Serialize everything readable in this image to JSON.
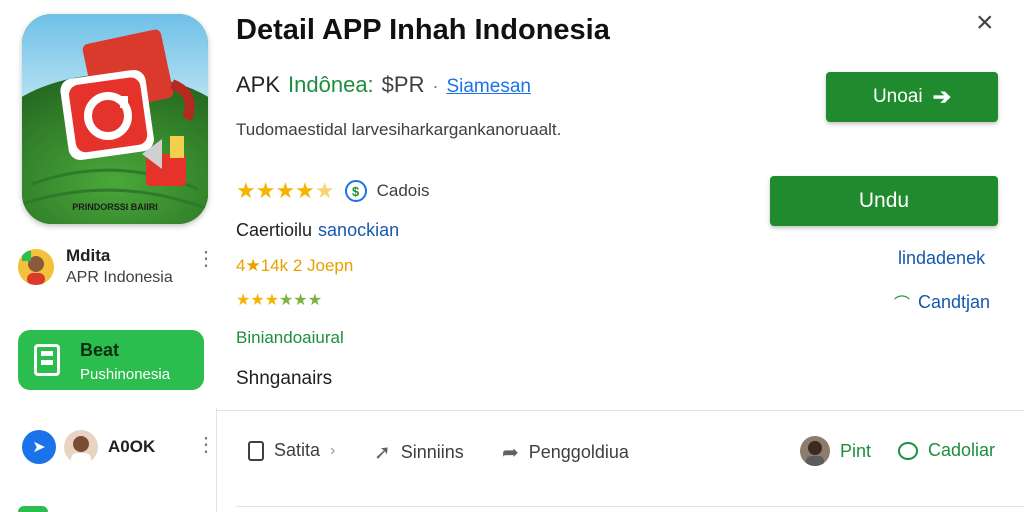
{
  "header": {
    "title": "Detail APP Inhah Indonesia",
    "close_icon": "close-icon"
  },
  "app": {
    "subtitle_prefix": "APK",
    "subtitle_green": "Indônea:",
    "subtitle_price": "$PR",
    "subtitle_dot": "·",
    "subtitle_link": "Siamesan",
    "description": "Tudomaestidal larvesiharkargankanoruaalt.",
    "icon_caption": "PRINDORSSI BAIIRI",
    "rating_stars": 4.5,
    "rating_label": "Cadois",
    "category_prefix": "Caertioilu",
    "category_link": "sanockian",
    "downloads_text": "4★14k 2 Joepn",
    "small_rating_stars": 5,
    "developer_label": "Biniandoaiural",
    "changes_label": "Shnganairs"
  },
  "buttons": {
    "primary_top": "Unoai",
    "primary_main": "Undu"
  },
  "right_links": {
    "link1": "lindadenek",
    "link2": "Candtjan"
  },
  "sidebar": {
    "profile": {
      "name": "Mdita",
      "sub": "APR Indonesia"
    },
    "card": {
      "title": "Beat",
      "sub": "Pushinonesia"
    },
    "bottom": {
      "name": "A0OK"
    }
  },
  "bottom_tabs": {
    "tab1": "Satita",
    "tab2": "Sinniins",
    "tab3": "Penggoldiua",
    "right1": "Pint",
    "right2": "Cadoliar"
  },
  "colors": {
    "green_button": "#1f8a2e",
    "accent_green": "#1e8e3e",
    "link_blue": "#1a73e8",
    "star_yellow": "#f4b400"
  }
}
